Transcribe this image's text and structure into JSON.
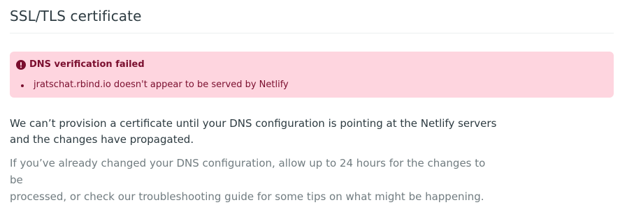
{
  "section": {
    "title": "SSL/TLS certificate"
  },
  "alert": {
    "icon": "exclamation-circle-icon",
    "title": "DNS verification failed",
    "items": [
      "jratschat.rbind.io doesn't appear to be served by Netlify"
    ],
    "colors": {
      "background": "#fed5df",
      "text": "#7a0e2e"
    }
  },
  "body": {
    "lead_line1": "We can’t provision a certificate until your DNS configuration is pointing at the Netlify servers",
    "lead_line2": "and the changes have propagated.",
    "desc_line1": "If you’ve already changed your DNS configuration, allow up to 24 hours for the changes to be",
    "desc_line2": "processed, or check our troubleshooting guide for some tips on what might be happening."
  }
}
